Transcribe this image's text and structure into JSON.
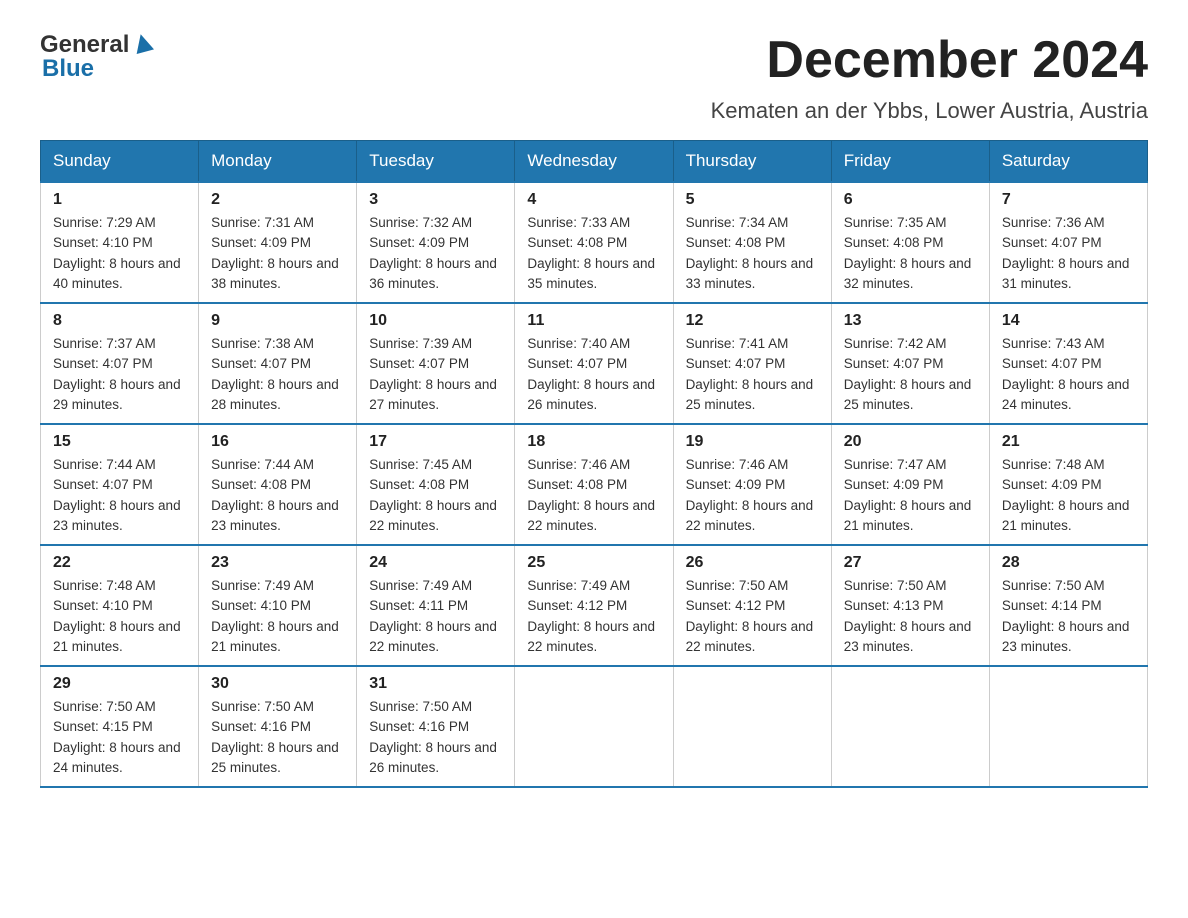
{
  "header": {
    "logo_general": "General",
    "logo_blue": "Blue",
    "month_title": "December 2024",
    "subtitle": "Kematen an der Ybbs, Lower Austria, Austria"
  },
  "weekdays": [
    "Sunday",
    "Monday",
    "Tuesday",
    "Wednesday",
    "Thursday",
    "Friday",
    "Saturday"
  ],
  "weeks": [
    [
      {
        "day": "1",
        "sunrise": "7:29 AM",
        "sunset": "4:10 PM",
        "daylight": "8 hours and 40 minutes."
      },
      {
        "day": "2",
        "sunrise": "7:31 AM",
        "sunset": "4:09 PM",
        "daylight": "8 hours and 38 minutes."
      },
      {
        "day": "3",
        "sunrise": "7:32 AM",
        "sunset": "4:09 PM",
        "daylight": "8 hours and 36 minutes."
      },
      {
        "day": "4",
        "sunrise": "7:33 AM",
        "sunset": "4:08 PM",
        "daylight": "8 hours and 35 minutes."
      },
      {
        "day": "5",
        "sunrise": "7:34 AM",
        "sunset": "4:08 PM",
        "daylight": "8 hours and 33 minutes."
      },
      {
        "day": "6",
        "sunrise": "7:35 AM",
        "sunset": "4:08 PM",
        "daylight": "8 hours and 32 minutes."
      },
      {
        "day": "7",
        "sunrise": "7:36 AM",
        "sunset": "4:07 PM",
        "daylight": "8 hours and 31 minutes."
      }
    ],
    [
      {
        "day": "8",
        "sunrise": "7:37 AM",
        "sunset": "4:07 PM",
        "daylight": "8 hours and 29 minutes."
      },
      {
        "day": "9",
        "sunrise": "7:38 AM",
        "sunset": "4:07 PM",
        "daylight": "8 hours and 28 minutes."
      },
      {
        "day": "10",
        "sunrise": "7:39 AM",
        "sunset": "4:07 PM",
        "daylight": "8 hours and 27 minutes."
      },
      {
        "day": "11",
        "sunrise": "7:40 AM",
        "sunset": "4:07 PM",
        "daylight": "8 hours and 26 minutes."
      },
      {
        "day": "12",
        "sunrise": "7:41 AM",
        "sunset": "4:07 PM",
        "daylight": "8 hours and 25 minutes."
      },
      {
        "day": "13",
        "sunrise": "7:42 AM",
        "sunset": "4:07 PM",
        "daylight": "8 hours and 25 minutes."
      },
      {
        "day": "14",
        "sunrise": "7:43 AM",
        "sunset": "4:07 PM",
        "daylight": "8 hours and 24 minutes."
      }
    ],
    [
      {
        "day": "15",
        "sunrise": "7:44 AM",
        "sunset": "4:07 PM",
        "daylight": "8 hours and 23 minutes."
      },
      {
        "day": "16",
        "sunrise": "7:44 AM",
        "sunset": "4:08 PM",
        "daylight": "8 hours and 23 minutes."
      },
      {
        "day": "17",
        "sunrise": "7:45 AM",
        "sunset": "4:08 PM",
        "daylight": "8 hours and 22 minutes."
      },
      {
        "day": "18",
        "sunrise": "7:46 AM",
        "sunset": "4:08 PM",
        "daylight": "8 hours and 22 minutes."
      },
      {
        "day": "19",
        "sunrise": "7:46 AM",
        "sunset": "4:09 PM",
        "daylight": "8 hours and 22 minutes."
      },
      {
        "day": "20",
        "sunrise": "7:47 AM",
        "sunset": "4:09 PM",
        "daylight": "8 hours and 21 minutes."
      },
      {
        "day": "21",
        "sunrise": "7:48 AM",
        "sunset": "4:09 PM",
        "daylight": "8 hours and 21 minutes."
      }
    ],
    [
      {
        "day": "22",
        "sunrise": "7:48 AM",
        "sunset": "4:10 PM",
        "daylight": "8 hours and 21 minutes."
      },
      {
        "day": "23",
        "sunrise": "7:49 AM",
        "sunset": "4:10 PM",
        "daylight": "8 hours and 21 minutes."
      },
      {
        "day": "24",
        "sunrise": "7:49 AM",
        "sunset": "4:11 PM",
        "daylight": "8 hours and 22 minutes."
      },
      {
        "day": "25",
        "sunrise": "7:49 AM",
        "sunset": "4:12 PM",
        "daylight": "8 hours and 22 minutes."
      },
      {
        "day": "26",
        "sunrise": "7:50 AM",
        "sunset": "4:12 PM",
        "daylight": "8 hours and 22 minutes."
      },
      {
        "day": "27",
        "sunrise": "7:50 AM",
        "sunset": "4:13 PM",
        "daylight": "8 hours and 23 minutes."
      },
      {
        "day": "28",
        "sunrise": "7:50 AM",
        "sunset": "4:14 PM",
        "daylight": "8 hours and 23 minutes."
      }
    ],
    [
      {
        "day": "29",
        "sunrise": "7:50 AM",
        "sunset": "4:15 PM",
        "daylight": "8 hours and 24 minutes."
      },
      {
        "day": "30",
        "sunrise": "7:50 AM",
        "sunset": "4:16 PM",
        "daylight": "8 hours and 25 minutes."
      },
      {
        "day": "31",
        "sunrise": "7:50 AM",
        "sunset": "4:16 PM",
        "daylight": "8 hours and 26 minutes."
      },
      null,
      null,
      null,
      null
    ]
  ]
}
